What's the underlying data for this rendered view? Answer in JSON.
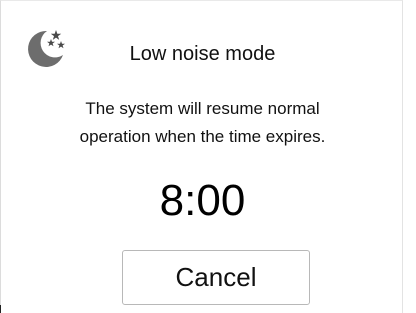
{
  "dialog": {
    "icon": "moon-stars-icon",
    "title": "Low noise mode",
    "message": "The system will resume normal operation when the time expires.",
    "timer": "8:00",
    "cancel_label": "Cancel"
  }
}
